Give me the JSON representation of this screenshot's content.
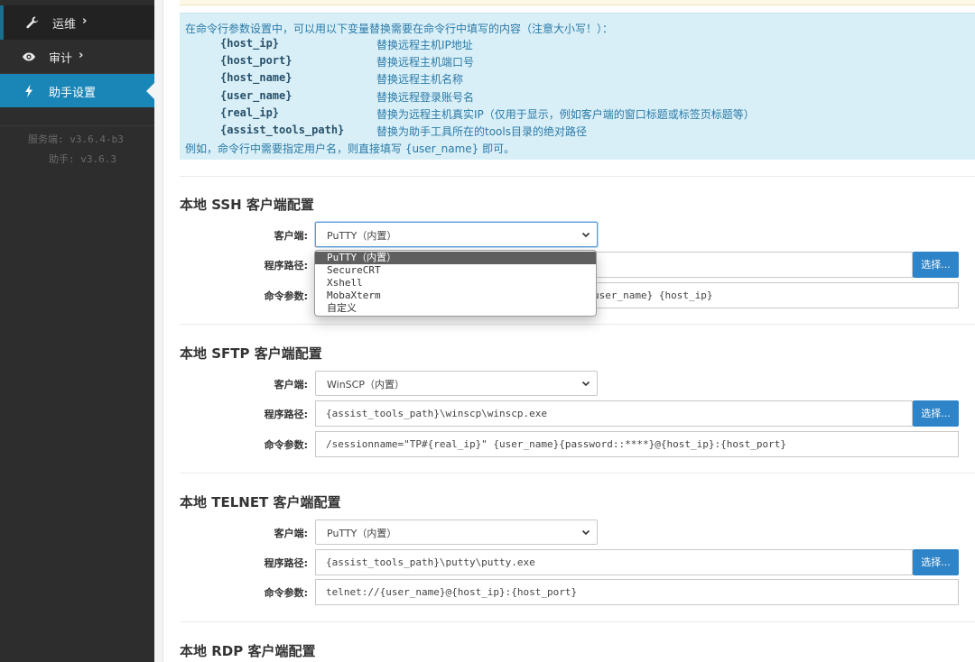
{
  "sidebar": {
    "items": [
      {
        "label": "运维",
        "icon": "wrench-icon"
      },
      {
        "label": "审计",
        "icon": "eye-icon"
      },
      {
        "label": "助手设置",
        "icon": "bolt-icon"
      }
    ],
    "server_version": "服务端: v3.6.4-b3",
    "assistant_version": "助手: v3.6.3"
  },
  "info": {
    "intro": "在命令行参数设置中，可以用以下变量替换需要在命令行中填写的内容（注意大小写！）：",
    "variables": [
      {
        "name": "{host_ip}",
        "desc": "替换远程主机IP地址"
      },
      {
        "name": "{host_port}",
        "desc": "替换远程主机端口号"
      },
      {
        "name": "{host_name}",
        "desc": "替换远程主机名称"
      },
      {
        "name": "{user_name}",
        "desc": "替换远程登录账号名"
      },
      {
        "name": "{real_ip}",
        "desc": "替换为远程主机真实IP（仅用于显示，例如客户端的窗口标题或标签页标题等）"
      },
      {
        "name": "{assist_tools_path}",
        "desc": "替换为助手工具所在的tools目录的绝对路径"
      }
    ],
    "example": "例如，命令行中需要指定用户名，则直接填写 {user_name} 即可。"
  },
  "labels": {
    "client": "客户端:",
    "path": "程序路径:",
    "args": "命令参数:",
    "browse": "选择..."
  },
  "ssh": {
    "title": "本地 SSH 客户端配置",
    "client": "PuTTY（内置）",
    "args_visible": "user_name} {host_ip}",
    "options": [
      "PuTTY（内置）",
      "SecureCRT",
      "Xshell",
      "MobaXterm",
      "自定义"
    ]
  },
  "sftp": {
    "title": "本地 SFTP 客户端配置",
    "client": "WinSCP（内置）",
    "path": "{assist_tools_path}\\winscp\\winscp.exe",
    "args": "/sessionname=\"TP#{real_ip}\" {user_name}{password::****}@{host_ip}:{host_port}"
  },
  "telnet": {
    "title": "本地 TELNET 客户端配置",
    "client": "PuTTY（内置）",
    "path": "{assist_tools_path}\\putty\\putty.exe",
    "args": "telnet://{user_name}@{host_ip}:{host_port}"
  },
  "rdp": {
    "title": "本地 RDP 客户端配置"
  },
  "colors": {
    "sidebar_bg": "#2d2d2d",
    "active_bg": "#1a86b8",
    "info_bg": "#d9eff7",
    "button_bg": "#2d84c8"
  }
}
